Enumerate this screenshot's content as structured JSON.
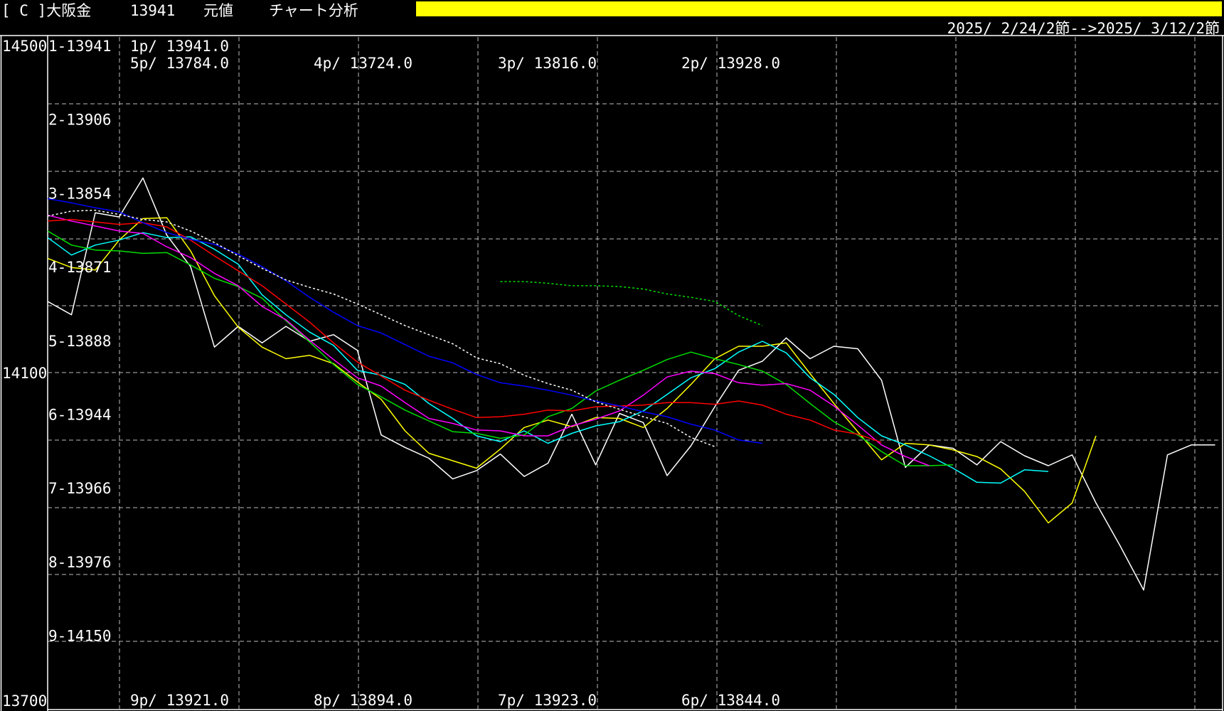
{
  "header": {
    "symbol": "[ C ]大阪金",
    "code": "13941",
    "series": "元値",
    "title": "チャート分析",
    "date_range": "2025/ 2/24/2節-->2025/ 3/12/2節",
    "bar_color": "#ffff00"
  },
  "chart_data": {
    "type": "line",
    "ylim": [
      13700,
      14500
    ],
    "y_ticks": [
      "14500",
      "14100",
      "13700"
    ],
    "row_labels": [
      "1-13941",
      "2-13906",
      "3-13854",
      "4-13871",
      "5-13888",
      "6-13944",
      "7-13966",
      "8-13976",
      "9-14150"
    ],
    "period_labels_top": [
      "1p/ 13941.0",
      "5p/ 13784.0",
      "4p/ 13724.0",
      "3p/ 13816.0",
      "2p/ 13928.0"
    ],
    "period_labels_bottom": [
      "9p/ 13921.0",
      "8p/ 13894.0",
      "7p/ 13923.0",
      "6p/ 13844.0"
    ],
    "x": [
      0,
      1,
      2,
      3,
      4,
      5,
      6,
      7,
      8,
      9,
      10,
      11,
      12,
      13,
      14,
      15,
      16,
      17,
      18,
      19,
      20,
      21,
      22,
      23,
      24,
      25,
      26,
      27,
      28,
      29,
      30,
      31,
      32,
      33,
      34,
      35,
      36,
      37,
      38,
      39,
      40,
      41,
      42,
      43,
      44,
      45,
      46,
      47,
      48,
      49
    ],
    "series": [
      {
        "color": "#ffffff",
        "style": "solid",
        "values": [
          14181,
          14165,
          14288,
          14283,
          14330,
          14261,
          14223,
          14126,
          14151,
          14131,
          14151,
          14133,
          14141,
          14122,
          14020,
          14005,
          13992,
          13967,
          13977,
          13997,
          13970,
          13986,
          14045,
          13984,
          14046,
          14035,
          13971,
          14007,
          14054,
          14098,
          14109,
          14137,
          14112,
          14127,
          14124,
          14086,
          13981,
          14008,
          14004,
          13984,
          14012,
          13995,
          13983,
          13996,
          13938,
          13887,
          13833,
          13996,
          14008,
          14008
        ]
      },
      {
        "color": "#ffff00",
        "style": "solid",
        "values": [
          14233,
          14222,
          14219,
          14255,
          14281,
          14282,
          14242,
          14188,
          14150,
          14126,
          14112,
          14116,
          14106,
          14084,
          14063,
          14025,
          13998,
          13989,
          13980,
          14003,
          14029,
          14038,
          14030,
          14041,
          14040,
          14029,
          14052,
          14081,
          14112,
          14127,
          14127,
          14131,
          14094,
          14058,
          14024,
          13990,
          14010,
          14008,
          14002,
          13994,
          13979,
          13952,
          13914,
          13938,
          14019
        ]
      },
      {
        "color": "#00ffff",
        "style": "solid",
        "values": [
          14258,
          14237,
          14249,
          14255,
          14264,
          14258,
          14259,
          14244,
          14226,
          14189,
          14165,
          14144,
          14128,
          14098,
          14092,
          14081,
          14058,
          14040,
          14019,
          14012,
          14025,
          14010,
          14022,
          14031,
          14036,
          14049,
          14069,
          14089,
          14100,
          14120,
          14133,
          14119,
          14089,
          14069,
          14041,
          14019,
          14008,
          13995,
          13980,
          13963,
          13962,
          13978,
          13976
        ]
      },
      {
        "color": "#00dd00",
        "style": "solid",
        "values": [
          14266,
          14249,
          14243,
          14242,
          14239,
          14240,
          14225,
          14209,
          14199,
          14185,
          14158,
          14132,
          14105,
          14081,
          14066,
          14050,
          14037,
          14024,
          14022,
          14016,
          14020,
          14042,
          14052,
          14073,
          14086,
          14098,
          14111,
          14120,
          14112,
          14105,
          14097,
          14081,
          14058,
          14036,
          14020,
          14000,
          13983,
          13983,
          13984
        ]
      },
      {
        "color": "#ff00ff",
        "style": "solid",
        "values": [
          14285,
          14278,
          14272,
          14266,
          14263,
          14247,
          14234,
          14215,
          14200,
          14175,
          14159,
          14134,
          14111,
          14089,
          14079,
          14059,
          14040,
          14034,
          14026,
          14025,
          14019,
          14019,
          14031,
          14039,
          14049,
          14068,
          14090,
          14097,
          14094,
          14083,
          14080,
          14082,
          14074,
          14055,
          14032,
          14008,
          13994,
          13983
        ]
      },
      {
        "color": "#ff0000",
        "style": "solid",
        "values": [
          14278,
          14280,
          14277,
          14274,
          14276,
          14271,
          14255,
          14236,
          14218,
          14200,
          14178,
          14156,
          14131,
          14108,
          14091,
          14074,
          14062,
          14051,
          14041,
          14042,
          14045,
          14050,
          14049,
          14054,
          14055,
          14056,
          14059,
          14059,
          14057,
          14061,
          14056,
          14045,
          14038,
          14026,
          14021,
          14011
        ]
      },
      {
        "color": "#0000ff",
        "style": "solid",
        "values": [
          14305,
          14300,
          14294,
          14289,
          14276,
          14264,
          14256,
          14250,
          14238,
          14223,
          14206,
          14186,
          14168,
          14152,
          14143,
          14129,
          14115,
          14107,
          14093,
          14083,
          14079,
          14074,
          14068,
          14061,
          14055,
          14048,
          14042,
          14033,
          14026,
          14014,
          14010
        ]
      },
      {
        "color": "#ffffff",
        "style": "dotted",
        "values": [
          14284,
          14290,
          14291,
          14286,
          14280,
          14277,
          14266,
          14252,
          14236,
          14221,
          14207,
          14198,
          14190,
          14178,
          14165,
          14152,
          14141,
          14130,
          14113,
          14106,
          14092,
          14082,
          14074,
          14060,
          14051,
          14042,
          14034,
          14017,
          14006
        ]
      },
      {
        "color": "#00dd00",
        "style": "dotted",
        "start": 19,
        "values": [
          14205,
          14205,
          14203,
          14200,
          14200,
          14199,
          14196,
          14190,
          14186,
          14181,
          14164,
          14152
        ]
      }
    ]
  }
}
